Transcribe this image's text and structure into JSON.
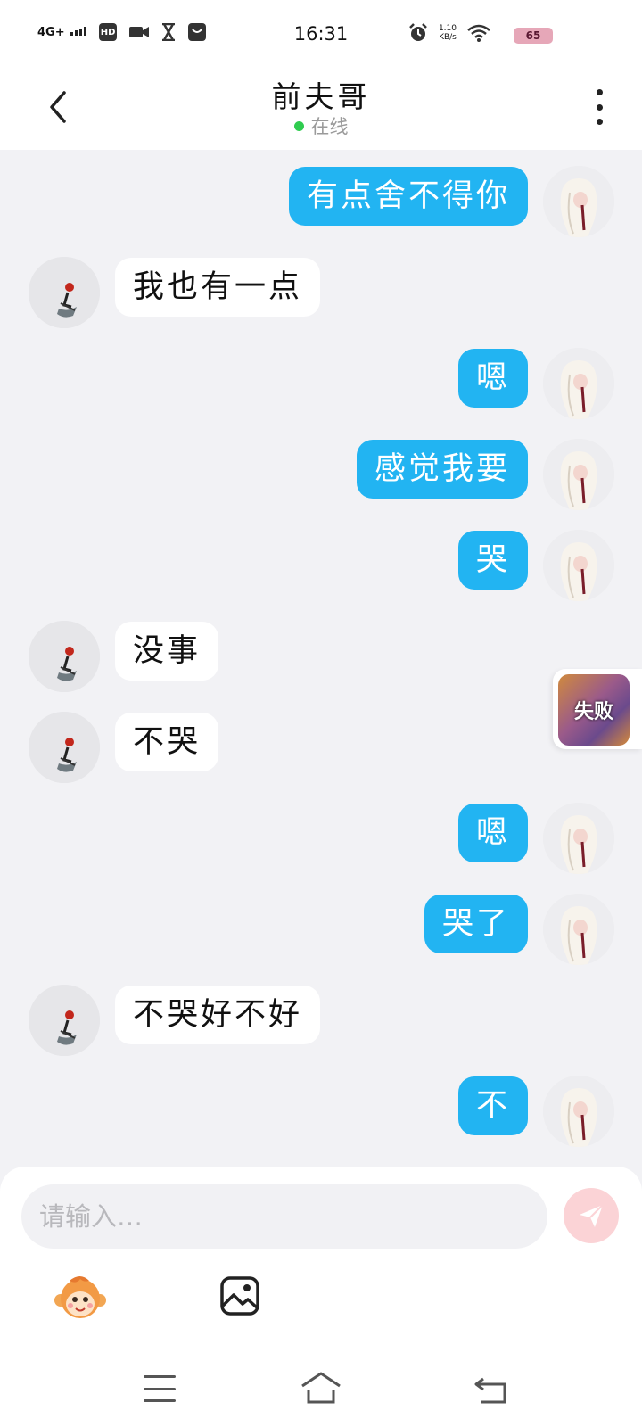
{
  "status_bar": {
    "network": "4G+",
    "hd": "HD",
    "time": "16:31",
    "speed_value": "1.10",
    "speed_unit": "KB/s",
    "battery": "65",
    "icons": [
      "video-icon",
      "hourglass-icon",
      "shopping-bag-icon",
      "alarm-icon",
      "wifi-icon"
    ]
  },
  "header": {
    "title": "前夫哥",
    "status": "在线",
    "status_color": "#2fcc4f"
  },
  "messages": [
    {
      "from": "me",
      "text": "有点舍不得你"
    },
    {
      "from": "peer",
      "text": "我也有一点"
    },
    {
      "from": "me",
      "text": "嗯"
    },
    {
      "from": "me",
      "text": "感觉我要"
    },
    {
      "from": "me",
      "text": "哭"
    },
    {
      "from": "peer",
      "text": "没事"
    },
    {
      "from": "peer",
      "text": "不哭"
    },
    {
      "from": "me",
      "text": "嗯"
    },
    {
      "from": "me",
      "text": "哭了"
    },
    {
      "from": "peer",
      "text": "不哭好不好"
    },
    {
      "from": "me",
      "text": "不"
    }
  ],
  "float_widget": {
    "label": "失败"
  },
  "composer": {
    "placeholder": "请输入…",
    "value": "",
    "send_icon": "paper-plane-icon",
    "accent": "#22b4f2"
  }
}
